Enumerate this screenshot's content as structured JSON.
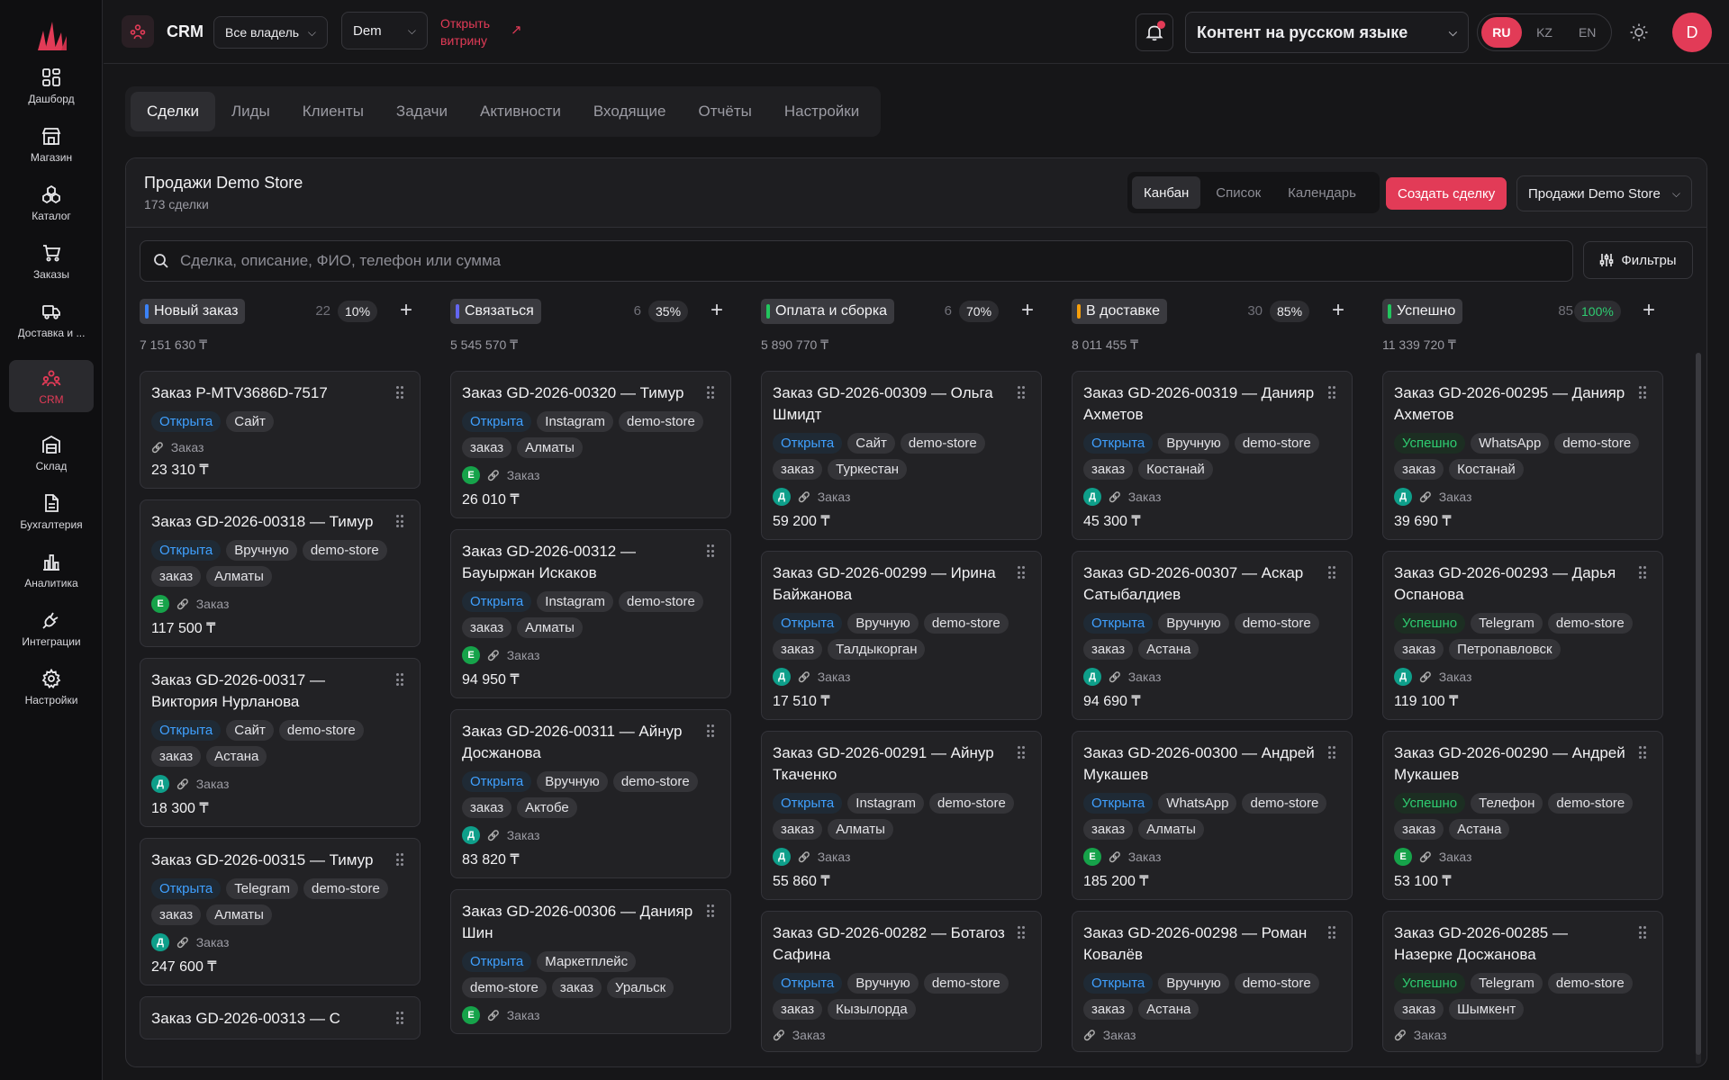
{
  "sidebar": {
    "items": [
      {
        "label": "Дашборд",
        "icon": "dashboard-icon"
      },
      {
        "label": "Магазин",
        "icon": "store-icon"
      },
      {
        "label": "Каталог",
        "icon": "catalog-icon"
      },
      {
        "label": "Заказы",
        "icon": "cart-icon"
      },
      {
        "label": "Доставка и ...",
        "icon": "truck-icon"
      },
      {
        "label": "CRM",
        "icon": "people-icon"
      },
      {
        "label": "Склад",
        "icon": "warehouse-icon"
      },
      {
        "label": "Бухгалтерия",
        "icon": "document-icon"
      },
      {
        "label": "Аналитика",
        "icon": "bar-chart-icon"
      },
      {
        "label": "Интеграции",
        "icon": "plug-icon"
      },
      {
        "label": "Настройки",
        "icon": "gear-icon"
      }
    ]
  },
  "topbar": {
    "title": "CRM",
    "owner_filter": "Все владельцы",
    "store_select": "Dem",
    "storefront_line1": "Открыть",
    "storefront_line2": "витрину",
    "content_lang": "Контент на русском языке",
    "langs": [
      "RU",
      "KZ",
      "EN"
    ],
    "avatar": "D"
  },
  "tabs": [
    "Сделки",
    "Лиды",
    "Клиенты",
    "Задачи",
    "Активности",
    "Входящие",
    "Отчёты",
    "Настройки"
  ],
  "panel": {
    "title": "Продажи Demo Store",
    "subtitle": "173 сделки",
    "views": [
      "Канбан",
      "Список",
      "Календарь"
    ],
    "create_label": "Создать сделку",
    "pipeline": "Продажи Demo Store",
    "search_placeholder": "Сделка, описание, ФИО, телефон или сумма",
    "filters_label": "Фильтры"
  },
  "colors": {
    "accent": "#e23b57",
    "blue": "#3b82f6",
    "indigo": "#6366f1",
    "green": "#22c55e",
    "amber": "#f59e0b"
  },
  "meta_label": "Заказ",
  "columns": [
    {
      "name": "Новый заказ",
      "color": "#3b82f6",
      "count": "22",
      "pct": "10%",
      "sum": "7 151 630 ₸",
      "cards": [
        {
          "title": "Заказ P-MTV3686D-7517",
          "status": "Открыта",
          "tags": [
            "Сайт"
          ],
          "avatar": "",
          "amount": "23 310 ₸"
        },
        {
          "title": "Заказ GD-2026-00318 — Тимур",
          "status": "Открыта",
          "tags": [
            "Вручную",
            "demo-store",
            "заказ",
            "Алматы"
          ],
          "avatar": "Е",
          "amount": "117 500 ₸"
        },
        {
          "title": "Заказ GD-2026-00317 — Виктория Нурланова",
          "status": "Открыта",
          "tags": [
            "Сайт",
            "demo-store",
            "заказ",
            "Астана"
          ],
          "avatar": "Д",
          "amount": "18 300 ₸"
        },
        {
          "title": "Заказ GD-2026-00315 — Тимур",
          "status": "Открыта",
          "tags": [
            "Telegram",
            "demo-store",
            "заказ",
            "Алматы"
          ],
          "avatar": "Д",
          "amount": "247 600 ₸"
        },
        {
          "title": "Заказ GD-2026-00313 — С",
          "status": "",
          "tags": [],
          "avatar": "",
          "amount": ""
        }
      ]
    },
    {
      "name": "Связаться",
      "color": "#6366f1",
      "count": "6",
      "pct": "35%",
      "sum": "5 545 570 ₸",
      "cards": [
        {
          "title": "Заказ GD-2026-00320 — Тимур",
          "status": "Открыта",
          "tags": [
            "Instagram",
            "demo-store",
            "заказ",
            "Алматы"
          ],
          "avatar": "Е",
          "amount": "26 010 ₸"
        },
        {
          "title": "Заказ GD-2026-00312 — Бауыржан Искаков",
          "status": "Открыта",
          "tags": [
            "Instagram",
            "demo-store",
            "заказ",
            "Алматы"
          ],
          "avatar": "Е",
          "amount": "94 950 ₸"
        },
        {
          "title": "Заказ GD-2026-00311 — Айнур Досжанова",
          "status": "Открыта",
          "tags": [
            "Вручную",
            "demo-store",
            "заказ",
            "Актобе"
          ],
          "avatar": "Д",
          "amount": "83 820 ₸"
        },
        {
          "title": "Заказ GD-2026-00306 — Данияр Шин",
          "status": "Открыта",
          "tags": [
            "Маркетплейс",
            "demo-store",
            "заказ",
            "Уральск"
          ],
          "avatar": "Е",
          "amount": ""
        }
      ]
    },
    {
      "name": "Оплата и сборка",
      "color": "#22c55e",
      "count": "6",
      "pct": "70%",
      "sum": "5 890 770 ₸",
      "cards": [
        {
          "title": "Заказ GD-2026-00309 — Ольга Шмидт",
          "status": "Открыта",
          "tags": [
            "Сайт",
            "demo-store",
            "заказ",
            "Туркестан"
          ],
          "avatar": "Д",
          "amount": "59 200 ₸"
        },
        {
          "title": "Заказ GD-2026-00299 — Ирина Байжанова",
          "status": "Открыта",
          "tags": [
            "Вручную",
            "demo-store",
            "заказ",
            "Талдыкорган"
          ],
          "avatar": "Д",
          "amount": "17 510 ₸"
        },
        {
          "title": "Заказ GD-2026-00291 — Айнур Ткаченко",
          "status": "Открыта",
          "tags": [
            "Instagram",
            "demo-store",
            "заказ",
            "Алматы"
          ],
          "avatar": "Д",
          "amount": "55 860 ₸"
        },
        {
          "title": "Заказ GD-2026-00282 — Ботагоз Сафина",
          "status": "Открыта",
          "tags": [
            "Вручную",
            "demo-store",
            "заказ",
            "Кызылорда"
          ],
          "avatar": "",
          "amount": ""
        }
      ]
    },
    {
      "name": "В доставке",
      "color": "#f59e0b",
      "count": "30",
      "pct": "85%",
      "sum": "8 011 455 ₸",
      "cards": [
        {
          "title": "Заказ GD-2026-00319 — Данияр Ахметов",
          "status": "Открыта",
          "tags": [
            "Вручную",
            "demo-store",
            "заказ",
            "Костанай"
          ],
          "avatar": "Д",
          "amount": "45 300 ₸"
        },
        {
          "title": "Заказ GD-2026-00307 — Аскар Сатыбалдиев",
          "status": "Открыта",
          "tags": [
            "Вручную",
            "demo-store",
            "заказ",
            "Астана"
          ],
          "avatar": "Д",
          "amount": "94 690 ₸"
        },
        {
          "title": "Заказ GD-2026-00300 — Андрей Мукашев",
          "status": "Открыта",
          "tags": [
            "WhatsApp",
            "demo-store",
            "заказ",
            "Алматы"
          ],
          "avatar": "Е",
          "amount": "185 200 ₸"
        },
        {
          "title": "Заказ GD-2026-00298 — Роман Ковалёв",
          "status": "Открыта",
          "tags": [
            "Вручную",
            "demo-store",
            "заказ",
            "Астана"
          ],
          "avatar": "",
          "amount": ""
        }
      ]
    },
    {
      "name": "Успешно",
      "color": "#22c55e",
      "count": "85",
      "pct": "100%",
      "sum": "11 339 720 ₸",
      "cards": [
        {
          "title": "Заказ GD-2026-00295 — Данияр Ахметов",
          "status": "Успешно",
          "tags": [
            "WhatsApp",
            "demo-store",
            "заказ",
            "Костанай"
          ],
          "avatar": "Д",
          "amount": "39 690 ₸"
        },
        {
          "title": "Заказ GD-2026-00293 — Дарья Оспанова",
          "status": "Успешно",
          "tags": [
            "Telegram",
            "demo-store",
            "заказ",
            "Петропавловск"
          ],
          "avatar": "Д",
          "amount": "119 100 ₸"
        },
        {
          "title": "Заказ GD-2026-00290 — Андрей Мукашев",
          "status": "Успешно",
          "tags": [
            "Телефон",
            "demo-store",
            "заказ",
            "Астана"
          ],
          "avatar": "Е",
          "amount": "53 100 ₸"
        },
        {
          "title": "Заказ GD-2026-00285 — Назерке Досжанова",
          "status": "Успешно",
          "tags": [
            "Telegram",
            "demo-store",
            "заказ",
            "Шымкент"
          ],
          "avatar": "",
          "amount": ""
        }
      ]
    }
  ]
}
